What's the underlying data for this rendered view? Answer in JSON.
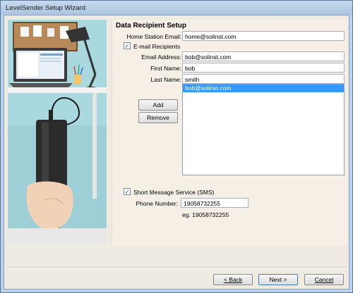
{
  "window": {
    "title": "LevelSender Setup Wizard"
  },
  "page": {
    "heading": "Data Recipient Setup"
  },
  "home_station_email": {
    "label": "Home Station Email:",
    "value": "home@solinst.com"
  },
  "email_recipients": {
    "label": "E-mail Recipients",
    "checked": true,
    "email_label": "Email Address:",
    "email_value": "bob@solinst.com",
    "first_name_label": "First Name:",
    "first_name_value": "bob",
    "last_name_label": "Last Name:",
    "last_name_value": "smith",
    "add_label": "Add",
    "remove_label": "Remove",
    "list": [
      "bob@solinst.com"
    ]
  },
  "sms": {
    "label": "Short Message Service (SMS)",
    "checked": true,
    "phone_label": "Phone Number:",
    "phone_value": "19058732255",
    "example": "eg. 19058732255"
  },
  "footer": {
    "back_label": "< Back",
    "next_label": "Next >",
    "cancel_label": "Cancel"
  },
  "icons": {
    "checkbox_mark": "check-mark"
  }
}
